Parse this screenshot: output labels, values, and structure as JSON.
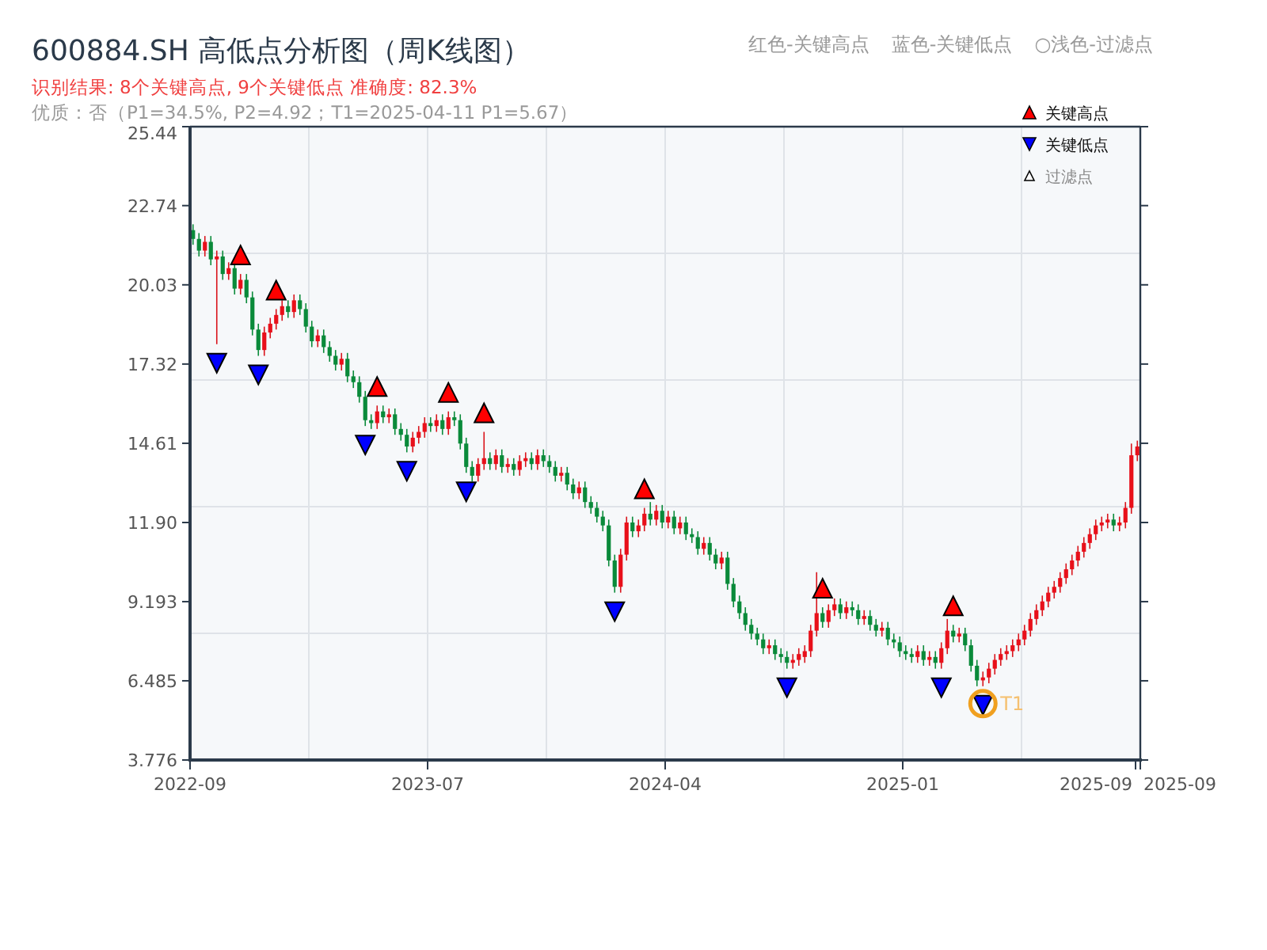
{
  "header": {
    "title": "600884.SH 高低点分析图（周K线图）",
    "result_line": "识别结果: 8个关键高点, 9个关键低点  准确度: 82.3%",
    "quality_line": "优质：否（P1=34.5%, P2=4.92；T1=2025-04-11 P1=5.67）",
    "color_key": [
      "红色-关键高点",
      "蓝色-关键低点",
      "○浅色-过滤点"
    ]
  },
  "chart": {
    "legend": [
      {
        "kind": "high",
        "label": "关键高点"
      },
      {
        "kind": "low",
        "label": "关键低点"
      },
      {
        "kind": "filtered",
        "label": "过滤点"
      }
    ],
    "target_label": "T1",
    "x_tick_labels": [
      "2022-09",
      "2023-07",
      "2024-04",
      "2025-01",
      "2025-09",
      "2025-09"
    ],
    "chart_data": {
      "type": "candlestick",
      "ylim": [
        3.776,
        25.44
      ],
      "yticks": [
        25.44,
        22.74,
        20.03,
        17.32,
        14.61,
        {
          "value": 11.9,
          "label": "11.90"
        },
        9.193,
        6.485,
        3.776
      ],
      "ohlc": [
        [
          21.9,
          22.1,
          21.4,
          21.6
        ],
        [
          21.6,
          21.8,
          21.0,
          21.2
        ],
        [
          21.2,
          21.7,
          21.0,
          21.5
        ],
        [
          21.5,
          21.7,
          20.7,
          20.9
        ],
        [
          20.9,
          21.2,
          18.0,
          21.0
        ],
        [
          21.0,
          21.2,
          20.2,
          20.4
        ],
        [
          20.4,
          20.8,
          20.2,
          20.6
        ],
        [
          20.6,
          20.8,
          19.7,
          19.9
        ],
        [
          19.9,
          20.4,
          19.7,
          20.2
        ],
        [
          20.2,
          20.4,
          19.4,
          19.6
        ],
        [
          19.6,
          19.8,
          18.3,
          18.5
        ],
        [
          18.5,
          18.7,
          17.6,
          17.8
        ],
        [
          17.8,
          18.6,
          17.6,
          18.4
        ],
        [
          18.4,
          18.9,
          18.2,
          18.7
        ],
        [
          18.7,
          19.2,
          18.5,
          19.0
        ],
        [
          19.0,
          19.5,
          18.8,
          19.3
        ],
        [
          19.3,
          19.5,
          18.9,
          19.1
        ],
        [
          19.1,
          19.7,
          18.9,
          19.5
        ],
        [
          19.5,
          19.7,
          19.0,
          19.2
        ],
        [
          19.2,
          19.4,
          18.4,
          18.6
        ],
        [
          18.6,
          18.8,
          17.9,
          18.1
        ],
        [
          18.1,
          18.5,
          17.9,
          18.3
        ],
        [
          18.3,
          18.5,
          17.7,
          17.9
        ],
        [
          17.9,
          18.1,
          17.4,
          17.6
        ],
        [
          17.6,
          17.8,
          17.1,
          17.3
        ],
        [
          17.3,
          17.7,
          17.1,
          17.5
        ],
        [
          17.5,
          17.7,
          16.7,
          16.9
        ],
        [
          16.9,
          17.1,
          16.5,
          16.7
        ],
        [
          16.7,
          16.9,
          16.0,
          16.2
        ],
        [
          16.2,
          16.4,
          15.2,
          15.4
        ],
        [
          15.4,
          15.6,
          15.1,
          15.3
        ],
        [
          15.3,
          15.9,
          15.1,
          15.7
        ],
        [
          15.7,
          15.9,
          15.3,
          15.5
        ],
        [
          15.5,
          15.8,
          15.3,
          15.6
        ],
        [
          15.6,
          15.8,
          14.9,
          15.1
        ],
        [
          15.1,
          15.3,
          14.7,
          14.9
        ],
        [
          14.9,
          15.1,
          14.3,
          14.5
        ],
        [
          14.5,
          15.0,
          14.3,
          14.8
        ],
        [
          14.8,
          15.2,
          14.6,
          15.0
        ],
        [
          15.0,
          15.5,
          14.8,
          15.3
        ],
        [
          15.3,
          15.5,
          15.0,
          15.2
        ],
        [
          15.2,
          15.6,
          15.0,
          15.4
        ],
        [
          15.4,
          15.6,
          14.9,
          15.1
        ],
        [
          15.1,
          15.7,
          14.9,
          15.5
        ],
        [
          15.5,
          15.7,
          15.2,
          15.4
        ],
        [
          15.4,
          15.6,
          14.4,
          14.6
        ],
        [
          14.6,
          14.8,
          13.6,
          13.8
        ],
        [
          13.8,
          14.0,
          13.3,
          13.5
        ],
        [
          13.5,
          14.1,
          13.3,
          13.9
        ],
        [
          13.9,
          15.0,
          13.7,
          14.1
        ],
        [
          14.1,
          14.3,
          13.7,
          13.9
        ],
        [
          13.9,
          14.4,
          13.7,
          14.2
        ],
        [
          14.2,
          14.4,
          13.6,
          13.8
        ],
        [
          13.8,
          14.1,
          13.6,
          13.9
        ],
        [
          13.9,
          14.1,
          13.5,
          13.7
        ],
        [
          13.7,
          14.2,
          13.5,
          14.0
        ],
        [
          14.0,
          14.3,
          13.8,
          14.1
        ],
        [
          14.1,
          14.3,
          13.7,
          13.9
        ],
        [
          13.9,
          14.4,
          13.7,
          14.2
        ],
        [
          14.2,
          14.4,
          13.8,
          14.0
        ],
        [
          14.0,
          14.2,
          13.6,
          13.8
        ],
        [
          13.8,
          14.0,
          13.3,
          13.5
        ],
        [
          13.5,
          13.8,
          13.3,
          13.6
        ],
        [
          13.6,
          13.8,
          13.0,
          13.2
        ],
        [
          13.2,
          13.4,
          12.7,
          12.9
        ],
        [
          12.9,
          13.3,
          12.7,
          13.1
        ],
        [
          13.1,
          13.3,
          12.4,
          12.6
        ],
        [
          12.6,
          12.8,
          12.2,
          12.4
        ],
        [
          12.4,
          12.6,
          11.9,
          12.1
        ],
        [
          12.1,
          12.3,
          11.6,
          11.8
        ],
        [
          11.8,
          12.0,
          10.4,
          10.6
        ],
        [
          10.6,
          10.8,
          9.5,
          9.7
        ],
        [
          9.7,
          11.0,
          9.5,
          10.8
        ],
        [
          10.8,
          12.1,
          10.6,
          11.9
        ],
        [
          11.9,
          12.1,
          11.4,
          11.6
        ],
        [
          11.6,
          12.0,
          11.4,
          11.8
        ],
        [
          11.8,
          12.4,
          11.6,
          12.2
        ],
        [
          12.2,
          12.6,
          11.8,
          12.0
        ],
        [
          12.0,
          12.5,
          11.8,
          12.3
        ],
        [
          12.3,
          12.5,
          11.7,
          11.9
        ],
        [
          11.9,
          12.3,
          11.7,
          12.1
        ],
        [
          12.1,
          12.3,
          11.5,
          11.7
        ],
        [
          11.7,
          12.1,
          11.5,
          11.9
        ],
        [
          11.9,
          12.1,
          11.3,
          11.5
        ],
        [
          11.5,
          11.7,
          11.2,
          11.4
        ],
        [
          11.4,
          11.6,
          10.8,
          11.0
        ],
        [
          11.0,
          11.4,
          10.8,
          11.2
        ],
        [
          11.2,
          11.4,
          10.6,
          10.8
        ],
        [
          10.8,
          11.0,
          10.3,
          10.5
        ],
        [
          10.5,
          10.9,
          10.3,
          10.7
        ],
        [
          10.7,
          10.9,
          9.6,
          9.8
        ],
        [
          9.8,
          10.0,
          9.0,
          9.2
        ],
        [
          9.2,
          9.4,
          8.6,
          8.8
        ],
        [
          8.8,
          9.0,
          8.2,
          8.4
        ],
        [
          8.4,
          8.6,
          7.9,
          8.1
        ],
        [
          8.1,
          8.3,
          7.7,
          7.9
        ],
        [
          7.9,
          8.1,
          7.4,
          7.6
        ],
        [
          7.6,
          7.9,
          7.4,
          7.7
        ],
        [
          7.7,
          7.9,
          7.2,
          7.4
        ],
        [
          7.4,
          7.6,
          7.1,
          7.3
        ],
        [
          7.3,
          7.5,
          6.9,
          7.1
        ],
        [
          7.1,
          7.4,
          6.9,
          7.2
        ],
        [
          7.2,
          7.6,
          7.0,
          7.4
        ],
        [
          7.3,
          7.7,
          7.1,
          7.5
        ],
        [
          7.5,
          8.4,
          7.3,
          8.2
        ],
        [
          8.2,
          10.2,
          8.0,
          8.8
        ],
        [
          8.8,
          9.0,
          8.3,
          8.5
        ],
        [
          8.5,
          9.1,
          8.3,
          8.9
        ],
        [
          8.9,
          9.3,
          8.7,
          9.1
        ],
        [
          9.1,
          9.3,
          8.6,
          8.8
        ],
        [
          8.8,
          9.2,
          8.6,
          9.0
        ],
        [
          9.0,
          9.2,
          8.7,
          8.9
        ],
        [
          8.9,
          9.1,
          8.4,
          8.6
        ],
        [
          8.6,
          8.9,
          8.4,
          8.7
        ],
        [
          8.7,
          8.9,
          8.2,
          8.4
        ],
        [
          8.4,
          8.6,
          8.0,
          8.2
        ],
        [
          8.2,
          8.5,
          8.0,
          8.3
        ],
        [
          8.3,
          8.5,
          7.7,
          7.9
        ],
        [
          7.9,
          8.1,
          7.6,
          7.8
        ],
        [
          7.8,
          8.0,
          7.3,
          7.5
        ],
        [
          7.5,
          7.7,
          7.2,
          7.4
        ],
        [
          7.4,
          7.6,
          7.1,
          7.3
        ],
        [
          7.3,
          7.7,
          7.1,
          7.5
        ],
        [
          7.5,
          7.7,
          7.0,
          7.2
        ],
        [
          7.2,
          7.5,
          7.0,
          7.3
        ],
        [
          7.3,
          7.5,
          6.9,
          7.1
        ],
        [
          7.1,
          7.8,
          6.9,
          7.6
        ],
        [
          7.6,
          8.6,
          7.4,
          8.2
        ],
        [
          8.2,
          8.4,
          7.8,
          8.0
        ],
        [
          8.0,
          8.3,
          7.8,
          8.1
        ],
        [
          8.1,
          8.3,
          7.5,
          7.7
        ],
        [
          7.7,
          7.9,
          6.8,
          7.0
        ],
        [
          7.0,
          7.2,
          6.3,
          6.5
        ],
        [
          6.5,
          6.8,
          6.3,
          6.6
        ],
        [
          6.6,
          7.1,
          6.4,
          6.9
        ],
        [
          6.9,
          7.4,
          6.7,
          7.2
        ],
        [
          7.2,
          7.6,
          7.0,
          7.4
        ],
        [
          7.4,
          7.7,
          7.2,
          7.5
        ],
        [
          7.5,
          7.9,
          7.3,
          7.7
        ],
        [
          7.7,
          8.1,
          7.5,
          7.9
        ],
        [
          7.9,
          8.4,
          7.7,
          8.2
        ],
        [
          8.2,
          8.8,
          8.0,
          8.6
        ],
        [
          8.6,
          9.1,
          8.4,
          8.9
        ],
        [
          8.9,
          9.4,
          8.7,
          9.2
        ],
        [
          9.2,
          9.7,
          9.0,
          9.5
        ],
        [
          9.5,
          9.9,
          9.3,
          9.7
        ],
        [
          9.7,
          10.2,
          9.5,
          10.0
        ],
        [
          10.0,
          10.5,
          9.8,
          10.3
        ],
        [
          10.3,
          10.8,
          10.1,
          10.6
        ],
        [
          10.6,
          11.1,
          10.4,
          10.9
        ],
        [
          10.9,
          11.4,
          10.7,
          11.2
        ],
        [
          11.2,
          11.7,
          11.0,
          11.5
        ],
        [
          11.5,
          12.0,
          11.3,
          11.8
        ],
        [
          11.8,
          12.1,
          11.6,
          11.9
        ],
        [
          11.9,
          12.2,
          11.7,
          12.0
        ],
        [
          12.0,
          12.2,
          11.6,
          11.8
        ],
        [
          11.8,
          12.1,
          11.6,
          11.9
        ],
        [
          11.9,
          12.6,
          11.7,
          12.4
        ],
        [
          12.4,
          14.6,
          12.2,
          14.2
        ],
        [
          14.2,
          14.7,
          14.0,
          14.5
        ]
      ]
    }
  }
}
